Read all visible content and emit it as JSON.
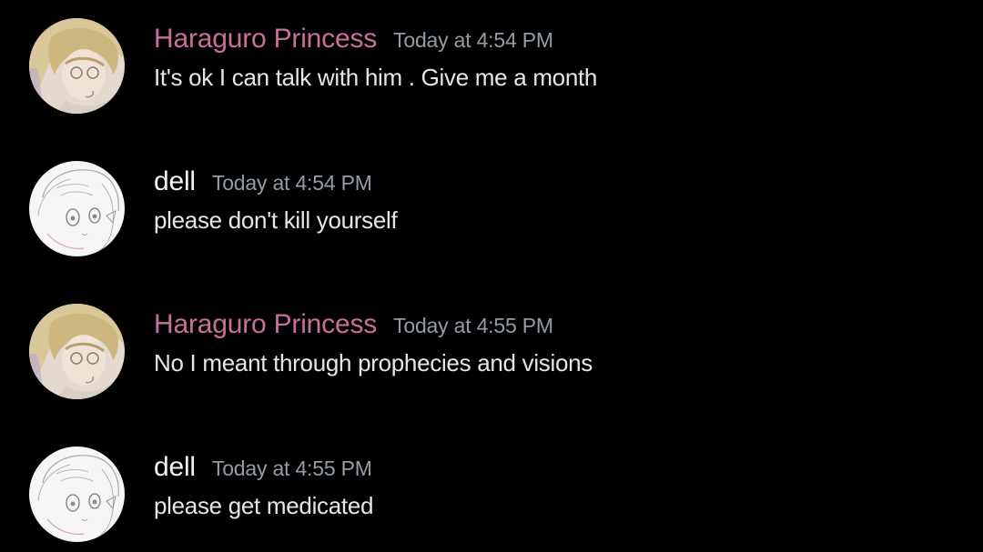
{
  "colors": {
    "background": "#000000",
    "princess_name": "#c96f9b",
    "dell_name": "#f2f3f5",
    "timestamp": "#949ba4",
    "message_text": "#e4e6ea"
  },
  "messages": [
    {
      "author": "Haraguro Princess",
      "timestamp": "Today at 4:54 PM",
      "content": "It's ok I can talk with him . Give me a month",
      "avatar_icon": "blonde-anime-character-avatar"
    },
    {
      "author": "dell",
      "timestamp": "Today at 4:54 PM",
      "content": "please don't kill yourself",
      "avatar_icon": "sketch-anime-character-avatar"
    },
    {
      "author": "Haraguro Princess",
      "timestamp": "Today at 4:55 PM",
      "content": "No I meant through prophecies and visions",
      "avatar_icon": "blonde-anime-character-avatar"
    },
    {
      "author": "dell",
      "timestamp": "Today at 4:55 PM",
      "content": "please get medicated",
      "avatar_icon": "sketch-anime-character-avatar"
    }
  ]
}
